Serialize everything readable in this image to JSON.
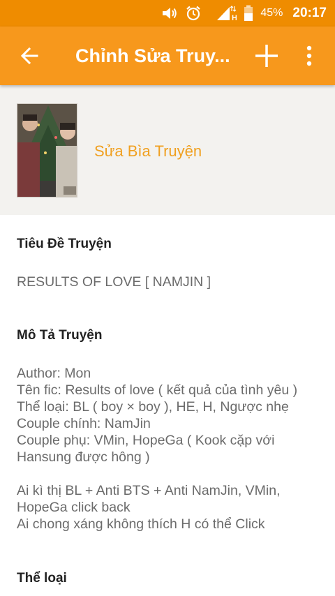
{
  "status_bar": {
    "battery_percent": "45%",
    "time": "20:17",
    "network_type": "H",
    "icons": [
      "volume-icon",
      "alarm-icon",
      "signal-icon",
      "battery-icon"
    ]
  },
  "toolbar": {
    "title": "Chỉnh Sửa Truy...",
    "back_icon": "arrow-back-icon",
    "add_icon": "plus-icon",
    "more_icon": "more-vert-icon"
  },
  "cover": {
    "edit_label": "Sửa Bìa Truyện"
  },
  "form": {
    "title_label": "Tiêu Đề Truyện",
    "title_value": "RESULTS OF LOVE [ NAMJIN ]",
    "description_label": "Mô Tả Truyện",
    "description_lines": [
      "Author: Mon",
      "Tên fic: Results of love ( kết quả của tình yêu )",
      "Thể loại: BL ( boy × boy ), HE, H, Ngược nhẹ",
      "Couple chính: NamJin",
      "Couple phụ: VMin, HopeGa ( Kook cặp với",
      "Hansung được hông )",
      "",
      "Ai kì thị BL + Anti BTS + Anti NamJin, VMin,",
      "HopeGa click back",
      "Ai chong xáng không thích H có thể Click"
    ],
    "genre_label": "Thể loại"
  },
  "colors": {
    "status_bar": "#ef8c00",
    "toolbar": "#f7981c",
    "accent_text": "#f0a020",
    "cover_bg": "#f3f2ef"
  }
}
